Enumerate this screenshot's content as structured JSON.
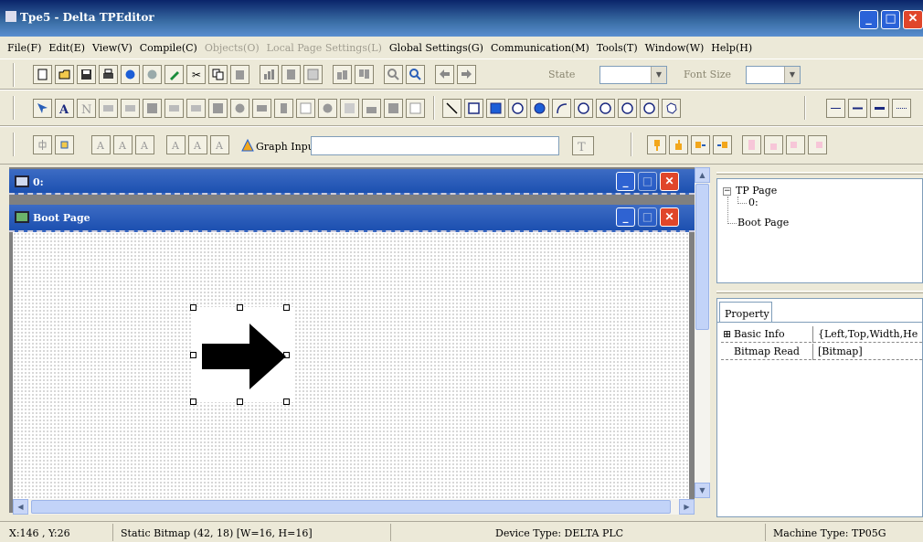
{
  "window": {
    "title": "Tpe5 - Delta TPEditor",
    "icon": "app-icon"
  },
  "menu": [
    {
      "label": "File(F)",
      "disabled": false
    },
    {
      "label": "Edit(E)",
      "disabled": false
    },
    {
      "label": "View(V)",
      "disabled": false
    },
    {
      "label": "Compile(C)",
      "disabled": false
    },
    {
      "label": "Objects(O)",
      "disabled": true
    },
    {
      "label": "Local Page Settings(L)",
      "disabled": true
    },
    {
      "label": "Global Settings(G)",
      "disabled": false
    },
    {
      "label": "Communication(M)",
      "disabled": false
    },
    {
      "label": "Tools(T)",
      "disabled": false
    },
    {
      "label": "Window(W)",
      "disabled": false
    },
    {
      "label": "Help(H)",
      "disabled": false
    }
  ],
  "toolbar1": {
    "state_label": "State",
    "state_value": "",
    "fontsize_label": "Font Size",
    "fontsize_value": ""
  },
  "toolbar3": {
    "graph_input_label": "Graph Input",
    "graph_input_value": ""
  },
  "child_windows": {
    "page0_title": "0:",
    "boot_title": "Boot Page"
  },
  "canvas_object": {
    "name": "Static Bitmap",
    "icon": "arrow-right-bitmap"
  },
  "tree": {
    "root": "TP Page",
    "child": "0:",
    "boot": "Boot Page"
  },
  "properties": {
    "tab": "Property",
    "rows": [
      {
        "name": "Basic Info",
        "value": "{Left,Top,Width,He",
        "expander": "⊞"
      },
      {
        "name": "Bitmap Read",
        "value": "[Bitmap]",
        "expander": ""
      }
    ]
  },
  "status": {
    "coords": "X:146 , Y:26",
    "selection": "Static Bitmap (42, 18) [W=16, H=16]",
    "device": "Device Type: DELTA PLC",
    "machine": "Machine Type: TP05G"
  }
}
